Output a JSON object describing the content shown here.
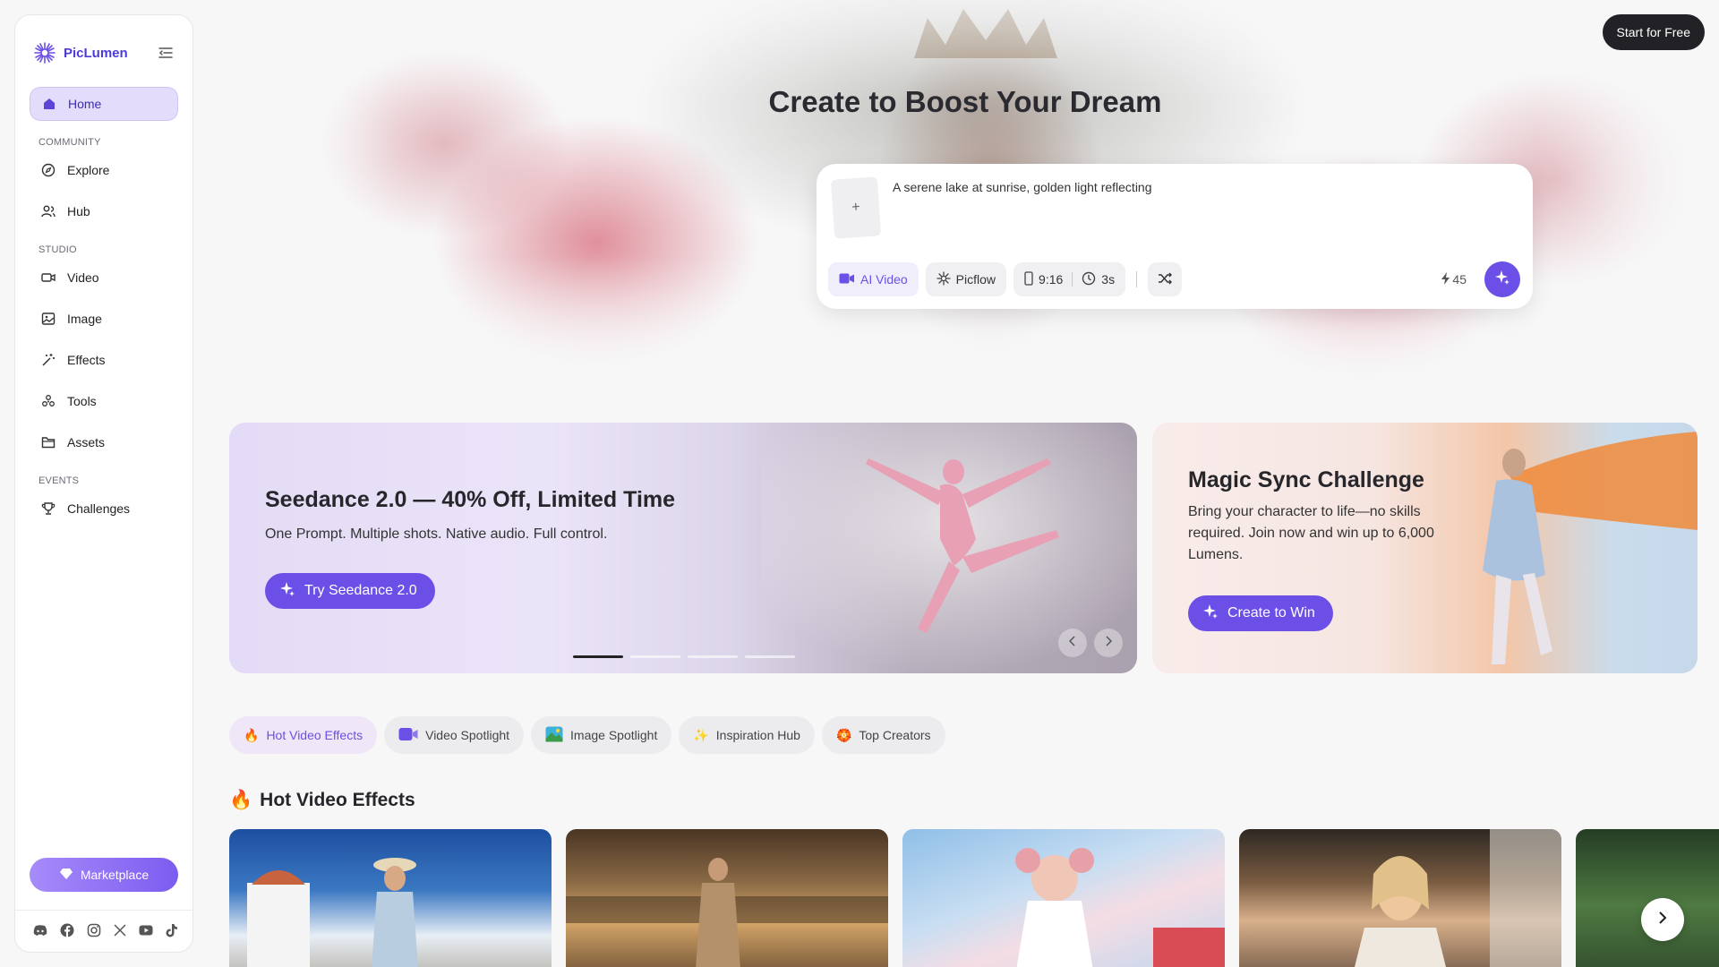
{
  "brand": {
    "name": "PicLumen"
  },
  "sidebar": {
    "items": [
      {
        "label": "Home",
        "icon": "home-icon"
      },
      {
        "label": "Explore",
        "icon": "compass-icon"
      },
      {
        "label": "Hub",
        "icon": "users-icon"
      },
      {
        "label": "Video",
        "icon": "video-icon"
      },
      {
        "label": "Image",
        "icon": "image-icon"
      },
      {
        "label": "Effects",
        "icon": "magic-wand-icon"
      },
      {
        "label": "Tools",
        "icon": "tools-icon"
      },
      {
        "label": "Assets",
        "icon": "folder-icon"
      },
      {
        "label": "Challenges",
        "icon": "trophy-icon"
      }
    ],
    "sections": {
      "community": "COMMUNITY",
      "studio": "STUDIO",
      "events": "EVENTS"
    },
    "marketplace_label": "Marketplace",
    "socials": [
      "discord-icon",
      "facebook-icon",
      "instagram-icon",
      "x-icon",
      "youtube-icon",
      "tiktok-icon"
    ]
  },
  "header": {
    "start_free_label": "Start for Free"
  },
  "hero": {
    "title": "Create to Boost Your Dream",
    "prompt_value": "A serene lake at sunrise, golden light reflecting",
    "upload_symbol": "+",
    "toolbar": {
      "mode_label": "AI Video",
      "model_label": "Picflow",
      "ratio_label": "9:16",
      "duration_label": "3s",
      "credits": "45"
    }
  },
  "banners": {
    "main": {
      "title": "Seedance 2.0 — 40% Off, Limited Time",
      "subtitle": "One Prompt. Multiple shots. Native audio. Full control.",
      "cta_label": "Try Seedance 2.0",
      "slides_total": 4,
      "slide_active": 1
    },
    "side": {
      "title": "Magic Sync Challenge",
      "subtitle": "Bring your character to life—no skills required. Join now and win up to 6,000 Lumens.",
      "cta_label": "Create to Win"
    }
  },
  "tabs": [
    {
      "label": "Hot Video Effects",
      "icon": "🔥",
      "active": true
    },
    {
      "label": "Video Spotlight",
      "icon": "video-icon",
      "active": false
    },
    {
      "label": "Image Spotlight",
      "icon": "landscape-icon",
      "active": false
    },
    {
      "label": "Inspiration Hub",
      "icon": "✨",
      "active": false
    },
    {
      "label": "Top Creators",
      "icon": "🏵️",
      "active": false
    }
  ],
  "section": {
    "title": "Hot Video Effects",
    "emoji": "🔥"
  },
  "colors": {
    "accent": "#6b4fe6",
    "active_nav_bg": "#e3dcfb",
    "dark_button": "#222226"
  }
}
